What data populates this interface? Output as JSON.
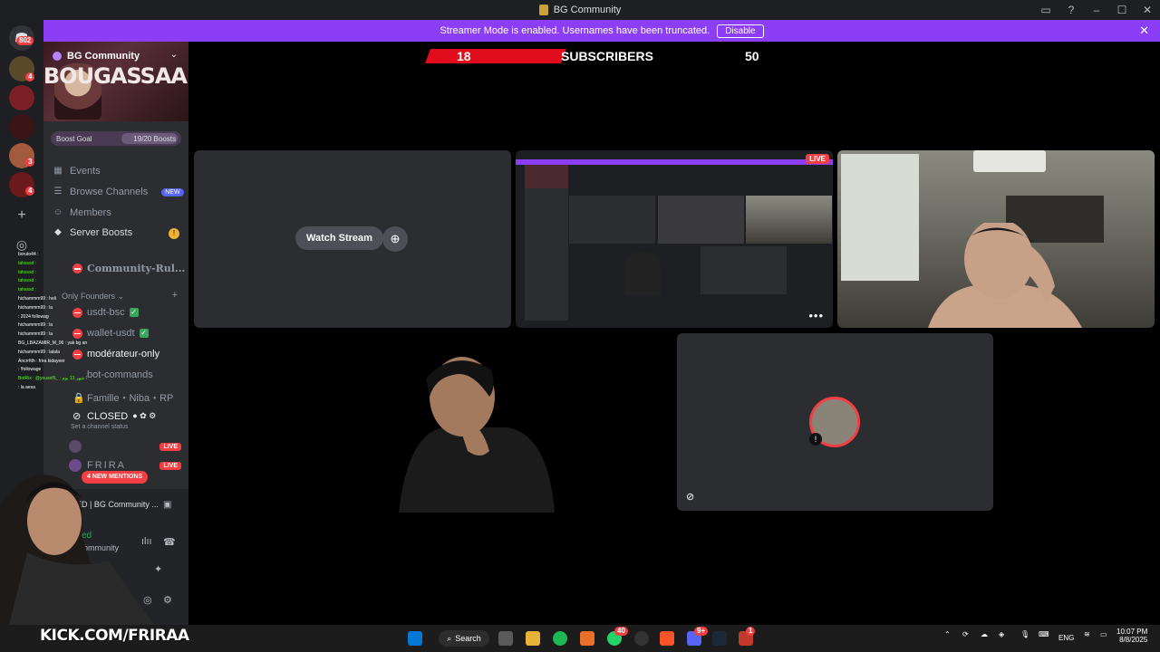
{
  "window": {
    "title": "BG Community"
  },
  "banner": {
    "text": "Streamer Mode is enabled. Usernames have been truncated.",
    "button": "Disable"
  },
  "server": {
    "name": "BG Community",
    "banner_art": "BOUGASSAA",
    "boost_goal_label": "Boost Goal",
    "boost_progress": "19/20 Boosts"
  },
  "server_badges": {
    "b1": "802",
    "b2": "4",
    "b3": "3",
    "b4": "4"
  },
  "nav": {
    "events": "Events",
    "browse": "Browse Channels",
    "browse_badge": "NEW",
    "members": "Members",
    "boosts": "Server Boosts",
    "boosts_warn": "!"
  },
  "channels": {
    "rules": "Community-Rul...",
    "category": "Only Founders",
    "usdt": "usdt-bsc",
    "wallet": "wallet-usdt",
    "moderateur": "modérateur-only",
    "bot": "bot-commands",
    "famille": "Famille・Niba・RP",
    "closed": "CLOSED",
    "status_placeholder": "Set a channel status"
  },
  "chat_overlay": [
    "boruto44 :",
    "tahsssd :",
    "tahsssd :",
    "tahsssd :",
    "tahsssd :",
    "hichammm99 : heli",
    "hichammm99 : la",
    ": 2024 followag",
    "hichammm99 : la",
    "hichammm99 : la",
    "BG_LBAZAMIR_M_06 : yak bg an lycum",
    "hichammm99 : lalala",
    "Ancrrfith : frira kidayeer",
    ": !followage",
    "BotRix : @yousef6_ : ساعات 17 شهر 13 يوم",
    ": la aesa"
  ],
  "live_rows": {
    "row1_badge": "LIVE",
    "row2_name": "FRIRA",
    "row2_badge": "LIVE"
  },
  "mentions": "4 NEW MENTIONS",
  "voice": {
    "connected_channel": "SED | BG Community ...",
    "status": "ed",
    "server_line": "ommunity"
  },
  "stream_overlay": {
    "left_value": "18",
    "label": "SUBSCRIBERS",
    "right_value": "50"
  },
  "tiles": {
    "watch_stream": "Watch Stream",
    "live_tag": "LIVE",
    "more": "•••"
  },
  "kick": {
    "text": "KICK.COM/FRIRAA"
  },
  "taskbar": {
    "search": "Search",
    "lang": "ENG",
    "time": "10:07 PM",
    "date": "8/8/2025",
    "whatsapp_badge": "40",
    "discord_badge": "9+",
    "app_badge": "1"
  },
  "colors": {
    "brand_purple": "#8c3ef7",
    "live_red": "#f23f43",
    "kick_green": "#53fc18",
    "blurple": "#5865f2"
  }
}
